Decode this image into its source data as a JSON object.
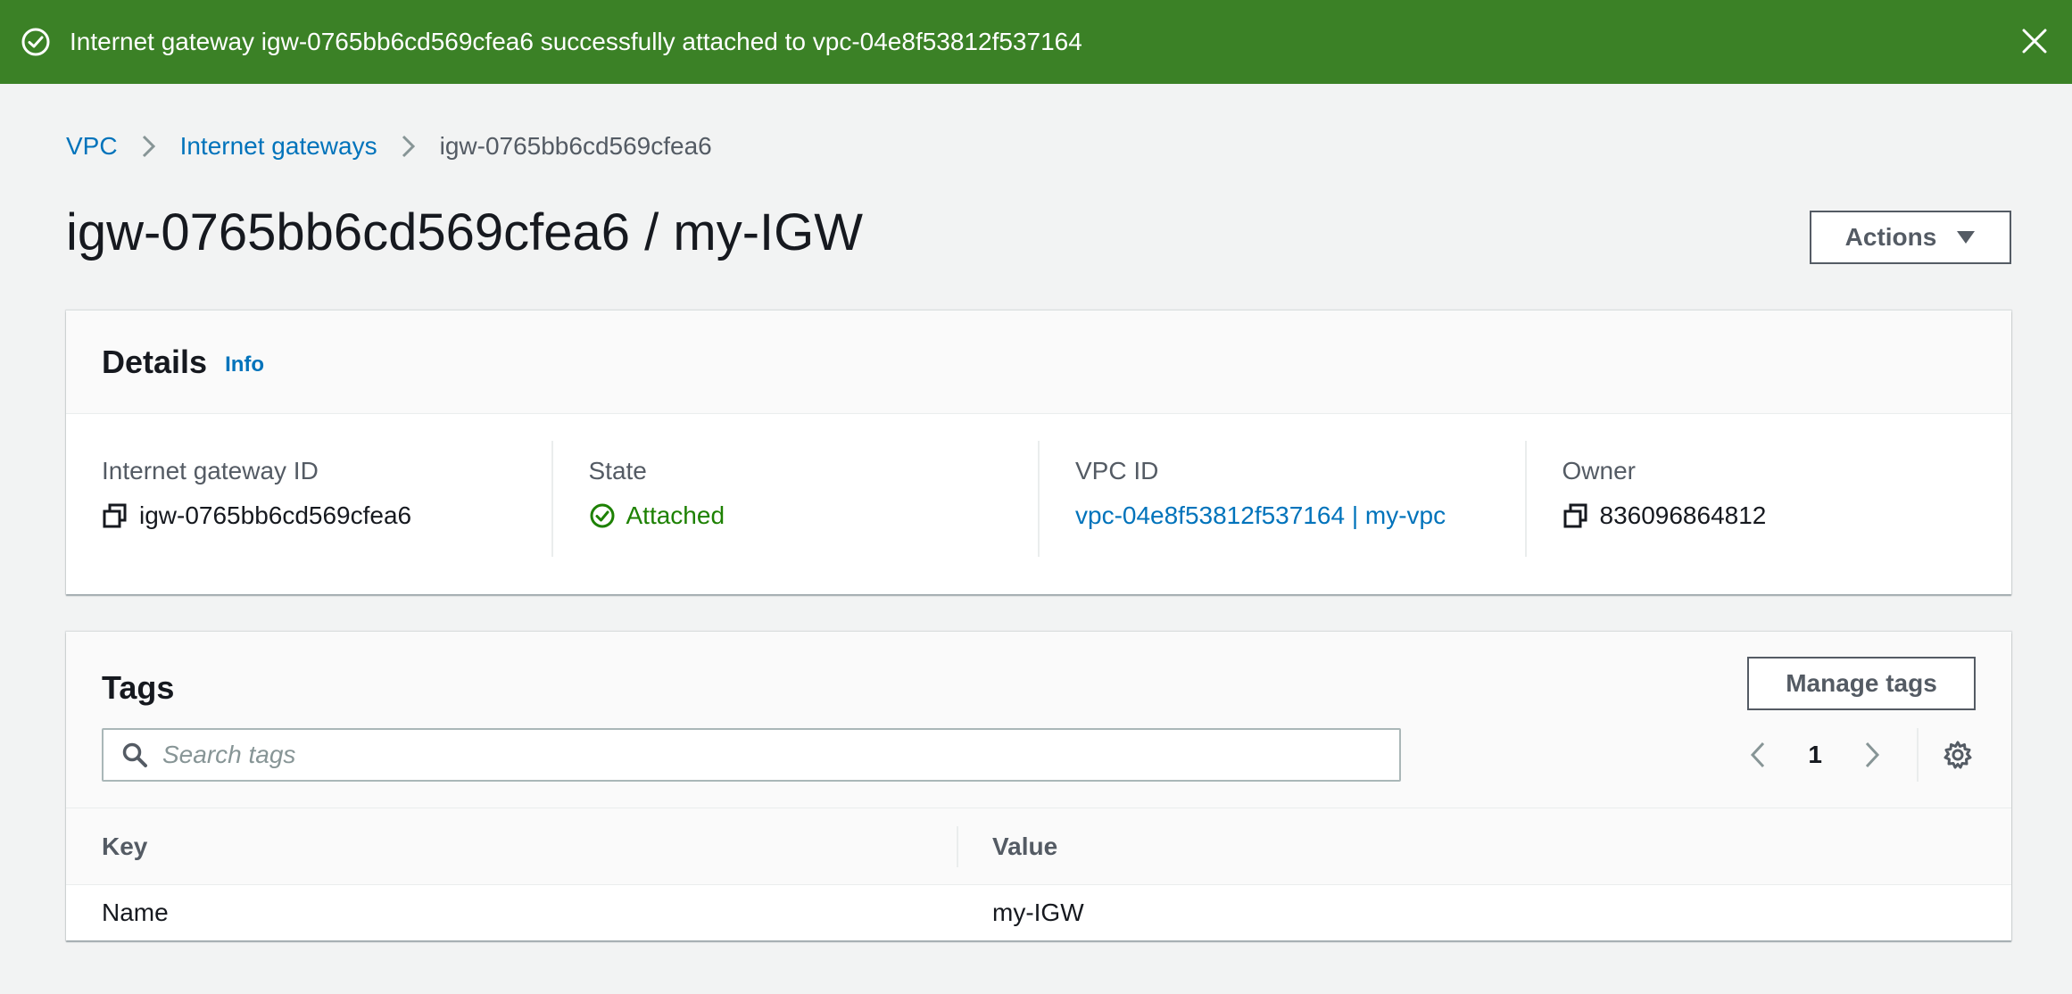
{
  "flash": {
    "message": "Internet gateway igw-0765bb6cd569cfea6 successfully attached to vpc-04e8f53812f537164",
    "color": "#3b8126"
  },
  "breadcrumb": [
    "VPC",
    "Internet gateways",
    "igw-0765bb6cd569cfea6"
  ],
  "page_title": "igw-0765bb6cd569cfea6 / my-IGW",
  "actions_label": "Actions",
  "details": {
    "title": "Details",
    "info_label": "Info",
    "fields": [
      {
        "label": "Internet gateway ID",
        "value": "igw-0765bb6cd569cfea6"
      },
      {
        "label": "State",
        "value": "Attached"
      },
      {
        "label": "VPC ID",
        "value": "vpc-04e8f53812f537164 | my-vpc"
      },
      {
        "label": "Owner",
        "value": "836096864812"
      }
    ]
  },
  "tags": {
    "title": "Tags",
    "manage_label": "Manage tags",
    "search_placeholder": "Search tags",
    "page": "1",
    "columns": [
      "Key",
      "Value"
    ],
    "rows": [
      {
        "key": "Name",
        "value": "my-IGW"
      }
    ]
  },
  "colors": {
    "link": "#0073bb",
    "success": "#1d8102",
    "background": "#f2f3f3"
  }
}
